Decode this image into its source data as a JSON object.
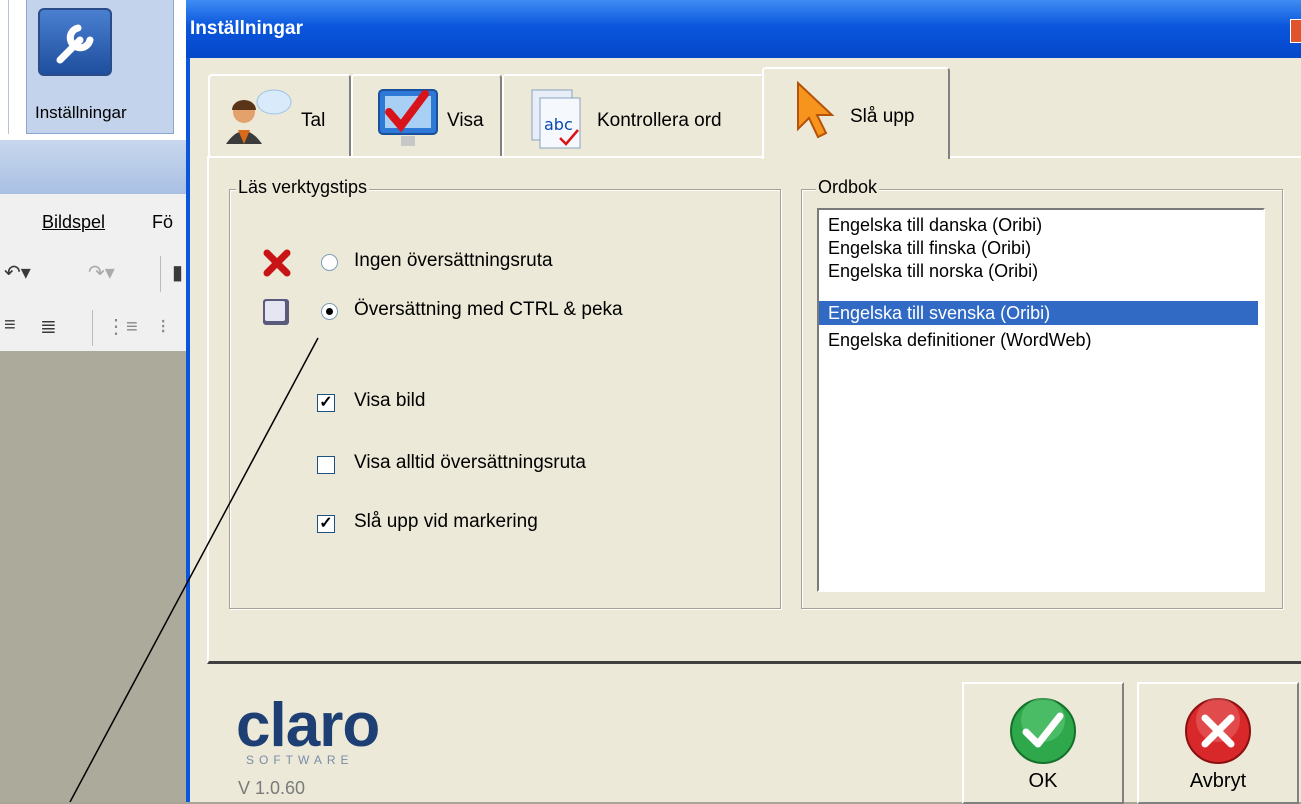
{
  "background_app": {
    "ribbon_button_label": "Inställningar",
    "menu_bildspel": "Bildspel",
    "menu_truncated": "Fö"
  },
  "dialog": {
    "title": "Inställningar",
    "tabs": [
      {
        "label": "Tal",
        "icon": "speaker-person-icon"
      },
      {
        "label": "Visa",
        "icon": "monitor-checkmark-icon"
      },
      {
        "label": "Kontrollera ord",
        "icon": "spellcheck-abc-icon"
      },
      {
        "label": "Slå upp",
        "icon": "cursor-arrow-icon",
        "active": true
      }
    ],
    "read_tooltips": {
      "title": "Läs verktygstips",
      "options": [
        {
          "label": "Ingen översättningsruta",
          "selected": false,
          "icon": "red-x-icon"
        },
        {
          "label": "Översättning med CTRL & peka",
          "selected": true,
          "icon": "key-icon"
        }
      ],
      "checkboxes": [
        {
          "label": "Visa bild",
          "checked": true
        },
        {
          "label": "Visa alltid översättningsruta",
          "checked": false
        },
        {
          "label": "Slå upp vid markering",
          "checked": true
        }
      ]
    },
    "dictionary": {
      "title": "Ordbok",
      "items": [
        "Engelska till danska (Oribi)",
        "Engelska till finska (Oribi)",
        "Engelska till norska (Oribi)",
        "Engelska till svenska (Oribi)",
        "Engelska definitioner (WordWeb)"
      ],
      "selected_index": 3
    },
    "logo_text": "claro",
    "logo_subtext": "SOFTWARE",
    "version": "V 1.0.60",
    "ok_label": "OK",
    "cancel_label": "Avbryt"
  },
  "colors": {
    "titlebar": "#0a56dd",
    "dialog_bg": "#ece9d8",
    "selection": "#316ac5",
    "ok_green": "#2ea84a",
    "cancel_red": "#d8282a"
  }
}
